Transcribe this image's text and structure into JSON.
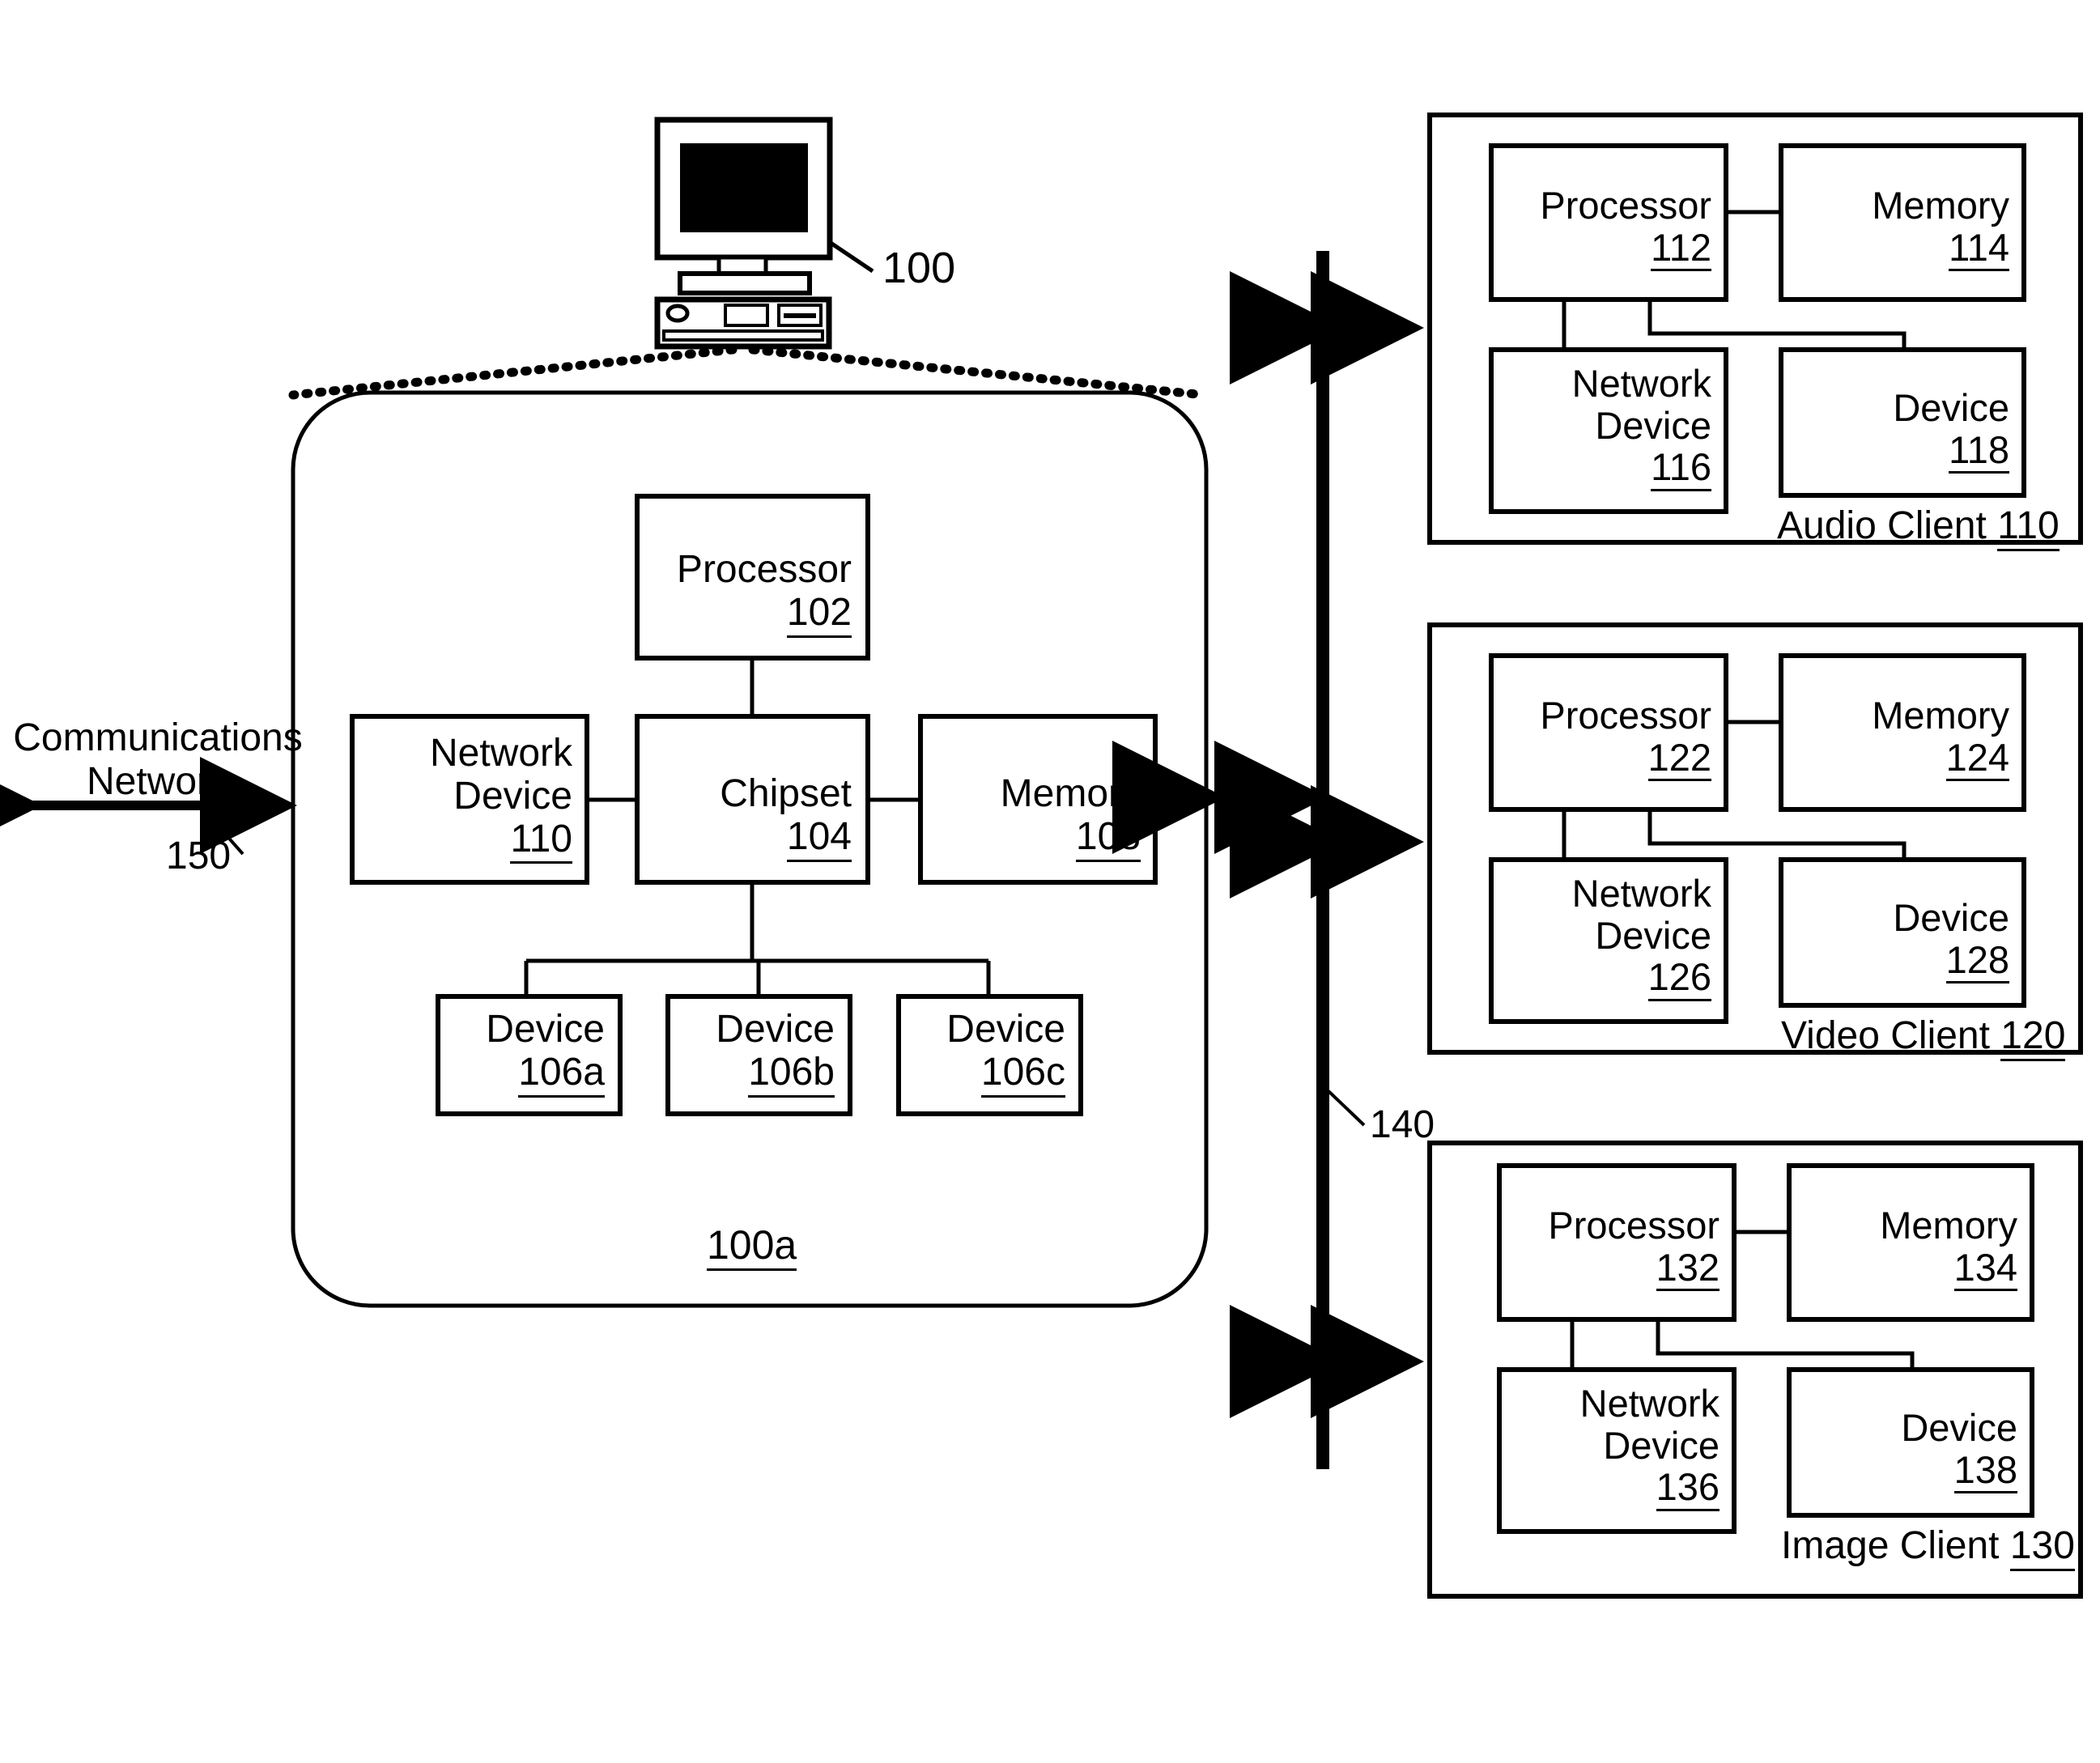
{
  "figure": {
    "type": "patent-block-diagram",
    "background": "#ffffff",
    "ink": "#000000"
  },
  "computer": {
    "icon": "desktop-computer-icon",
    "ref": "100"
  },
  "host_system": {
    "ref": "100a",
    "blocks": [
      {
        "id": "processor",
        "name": "Processor",
        "ref": "102"
      },
      {
        "id": "chipset",
        "name": "Chipset",
        "ref": "104"
      },
      {
        "id": "network_device",
        "name": "Network\nDevice",
        "name_line1": "Network",
        "name_line2": "Device",
        "ref": "110"
      },
      {
        "id": "memory",
        "name": "Memory",
        "ref": "108"
      },
      {
        "id": "device_a",
        "name": "Device",
        "ref": "106a"
      },
      {
        "id": "device_b",
        "name": "Device",
        "ref": "106b"
      },
      {
        "id": "device_c",
        "name": "Device",
        "ref": "106c"
      }
    ]
  },
  "communications_network": {
    "line1": "Communications",
    "line2": "Network",
    "ref": "150"
  },
  "bus": {
    "ref": "140"
  },
  "clients": [
    {
      "id": "audio_client",
      "label_text": "Audio Client",
      "label_ref": "110",
      "blocks": [
        {
          "id": "processor",
          "name": "Processor",
          "ref": "112"
        },
        {
          "id": "memory",
          "name": "Memory",
          "ref": "114"
        },
        {
          "id": "network_device",
          "name_line1": "Network",
          "name_line2": "Device",
          "ref": "116"
        },
        {
          "id": "device",
          "name": "Device",
          "ref": "118"
        }
      ]
    },
    {
      "id": "video_client",
      "label_text": "Video Client",
      "label_ref": "120",
      "blocks": [
        {
          "id": "processor",
          "name": "Processor",
          "ref": "122"
        },
        {
          "id": "memory",
          "name": "Memory",
          "ref": "124"
        },
        {
          "id": "network_device",
          "name_line1": "Network",
          "name_line2": "Device",
          "ref": "126"
        },
        {
          "id": "device",
          "name": "Device",
          "ref": "128"
        }
      ]
    },
    {
      "id": "image_client",
      "label_text": "Image Client",
      "label_ref": "130",
      "blocks": [
        {
          "id": "processor",
          "name": "Processor",
          "ref": "132"
        },
        {
          "id": "memory",
          "name": "Memory",
          "ref": "134"
        },
        {
          "id": "network_device",
          "name_line1": "Network",
          "name_line2": "Device",
          "ref": "136"
        },
        {
          "id": "device",
          "name": "Device",
          "ref": "138"
        }
      ]
    }
  ]
}
